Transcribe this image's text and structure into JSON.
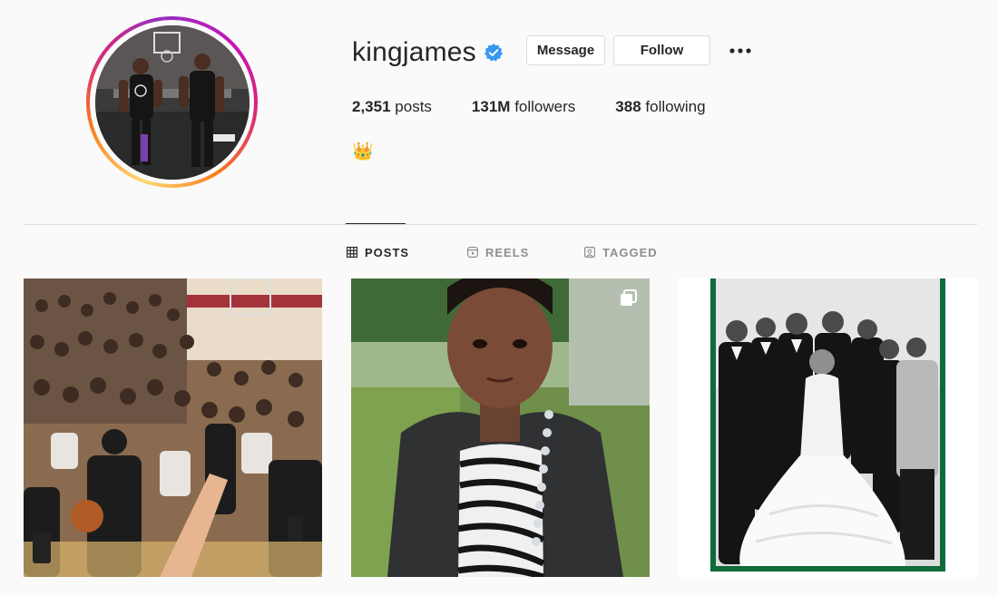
{
  "profile": {
    "username": "kingjames",
    "verified": true,
    "bio_emoji": "👑",
    "accent_verified": "#3897f0"
  },
  "actions": {
    "message_label": "Message",
    "follow_label": "Follow",
    "more_icon": "more-horizontal-icon"
  },
  "stats": {
    "posts_count": "2,351",
    "posts_label": "posts",
    "followers_count": "131M",
    "followers_label": "followers",
    "following_count": "388",
    "following_label": "following"
  },
  "tabs": [
    {
      "label": "POSTS",
      "icon": "grid-icon",
      "active": true
    },
    {
      "label": "REELS",
      "icon": "reels-icon",
      "active": false
    },
    {
      "label": "TAGGED",
      "icon": "tagged-icon",
      "active": false
    }
  ],
  "posts": [
    {
      "subject": "crowd-court-photo",
      "multiple": false
    },
    {
      "subject": "child-portrait-photo",
      "multiple": true
    },
    {
      "subject": "wedding-group-photo",
      "multiple": false
    }
  ]
}
